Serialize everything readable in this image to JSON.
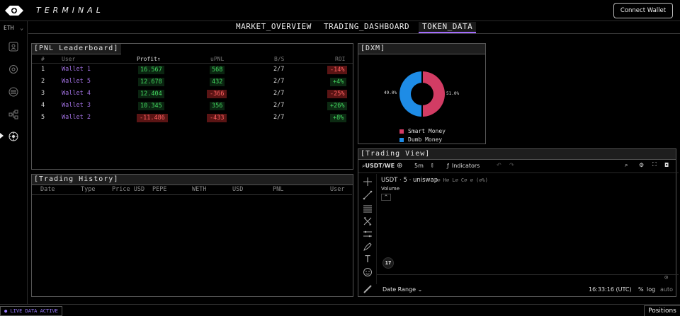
{
  "app": {
    "brand": "TERMINAL",
    "connect_label": "Connect Wallet"
  },
  "sidebar": {
    "chain": "ETH",
    "items": [
      "user-icon",
      "target-icon",
      "stack-icon",
      "network-icon",
      "radar-icon"
    ]
  },
  "nav": {
    "tabs": [
      {
        "label": "MARKET_OVERVIEW",
        "active": false
      },
      {
        "label": "TRADING_DASHBOARD",
        "active": false
      },
      {
        "label": "TOKEN_DATA",
        "active": true
      }
    ]
  },
  "leaderboard": {
    "title": "[PNL Leaderboard]",
    "columns": [
      "#",
      "User",
      "Profit",
      "uPNL",
      "B/S",
      "ROI"
    ],
    "sort_indicator": "↑",
    "rows": [
      {
        "rank": "1",
        "user": "Wallet 1",
        "profit": "16.567",
        "upnl": "568",
        "bs": "2/7",
        "roi": "-14%"
      },
      {
        "rank": "2",
        "user": "Wallet 5",
        "profit": "12.678",
        "upnl": "432",
        "bs": "2/7",
        "roi": "+4%"
      },
      {
        "rank": "3",
        "user": "Wallet 4",
        "profit": "12.404",
        "upnl": "-366",
        "bs": "2/7",
        "roi": "-25%"
      },
      {
        "rank": "4",
        "user": "Wallet 3",
        "profit": "10.345",
        "upnl": "356",
        "bs": "2/7",
        "roi": "+26%"
      },
      {
        "rank": "5",
        "user": "Wallet 2",
        "profit": "-11.486",
        "upnl": "-433",
        "bs": "2/7",
        "roi": "+8%"
      }
    ]
  },
  "history": {
    "title": "[Trading History]",
    "columns": [
      "Date",
      "Type",
      "Price USD",
      "PEPE",
      "WETH",
      "USD",
      "PNL",
      "User"
    ]
  },
  "dxm": {
    "title": "[DXM]",
    "smart_pct": "51.0%",
    "dumb_pct": "49.0%",
    "legend": [
      {
        "label": "Smart Money",
        "color": "#d23c64"
      },
      {
        "label": "Dumb Money",
        "color": "#1e8ce6"
      }
    ]
  },
  "tradingview": {
    "title": "[Trading View]",
    "symbol": "USDT/WE",
    "interval": "5m",
    "indicators_label": "Indicators",
    "chart_title": "USDT · 5 · uniswap",
    "ohlc": "O∅ H∅ L∅ C∅ ∅ (∅%)",
    "volume_label": "Volume",
    "date_range": "Date Range",
    "time": "16:33:16 (UTC)",
    "percent": "%",
    "log": "log",
    "auto": "auto"
  },
  "footer": {
    "live_label": "LIVE DATA ACTIVE",
    "positions_label": "Positions"
  }
}
